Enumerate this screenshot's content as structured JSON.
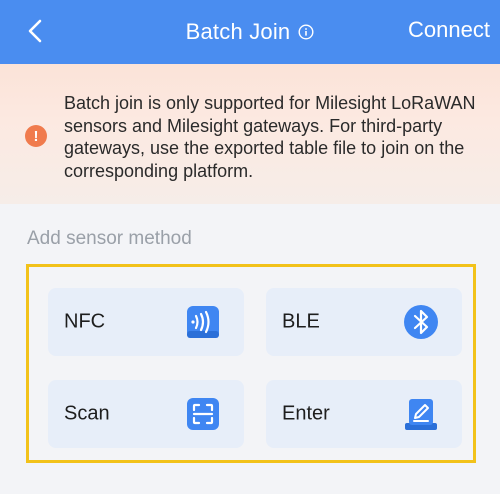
{
  "header": {
    "title": "Batch Join",
    "connect_label": "Connect",
    "background": "#4a8df0"
  },
  "notice": {
    "text": "Batch join is only supported for Milesight LoRaWAN sensors and Milesight gateways. For third-party gateways, use the exported table file to join on the corresponding platform.",
    "icon": "warning-icon",
    "icon_color": "#f07b4d"
  },
  "add_method": {
    "label": "Add sensor method",
    "highlight_color": "#f2c21a",
    "options": [
      {
        "label": "NFC",
        "icon": "nfc-icon"
      },
      {
        "label": "BLE",
        "icon": "bluetooth-icon"
      },
      {
        "label": "Scan",
        "icon": "scan-icon"
      },
      {
        "label": "Enter",
        "icon": "edit-icon"
      }
    ]
  }
}
